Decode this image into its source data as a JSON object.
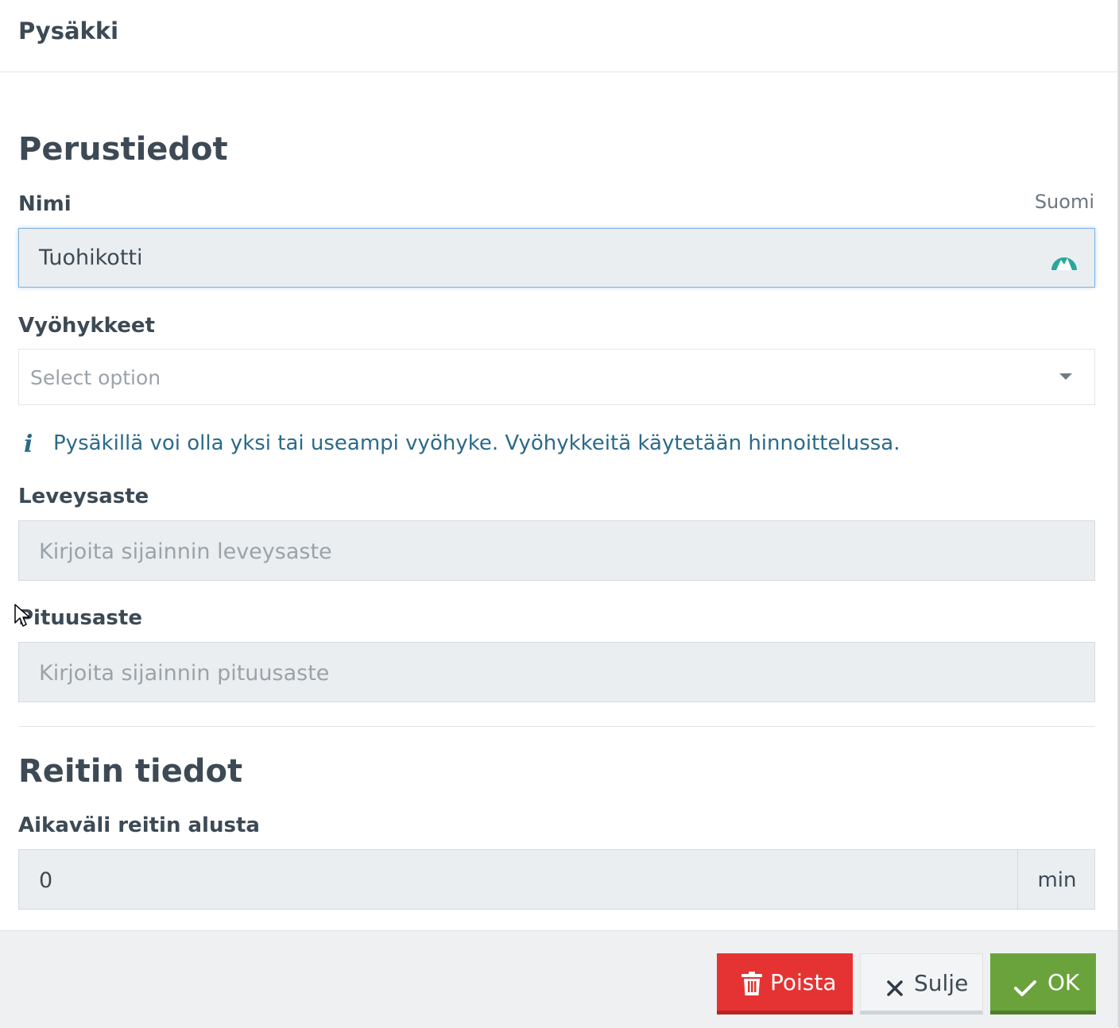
{
  "header": {
    "title": "Pysäkki"
  },
  "basic_info": {
    "section_title": "Perustiedot",
    "name": {
      "label": "Nimi",
      "language": "Suomi",
      "value": "Tuohikotti"
    },
    "zones": {
      "label": "Vyöhykkeet",
      "placeholder": "Select option",
      "info_text": "Pysäkillä voi olla yksi tai useampi vyöhyke. Vyöhykkeitä käytetään hinnoittelussa."
    },
    "latitude": {
      "label": "Leveysaste",
      "placeholder": "Kirjoita sijainnin leveysaste"
    },
    "longitude": {
      "label": "Pituusaste",
      "placeholder": "Kirjoita sijainnin pituusaste"
    }
  },
  "route_info": {
    "section_title": "Reitin tiedot",
    "interval": {
      "label": "Aikaväli reitin alusta",
      "value": "0",
      "unit": "min"
    }
  },
  "footer": {
    "delete_label": "Poista",
    "close_label": "Sulje",
    "ok_label": "OK"
  },
  "icons": {
    "info": "info-icon",
    "extension": "mountain-logo-icon",
    "delete": "trash-icon",
    "close": "close-icon",
    "ok": "check-icon"
  },
  "colors": {
    "delete": "#e53333",
    "ok": "#6aa33b",
    "info": "#2b6a8a",
    "extension_logo": "#2aa79b"
  }
}
